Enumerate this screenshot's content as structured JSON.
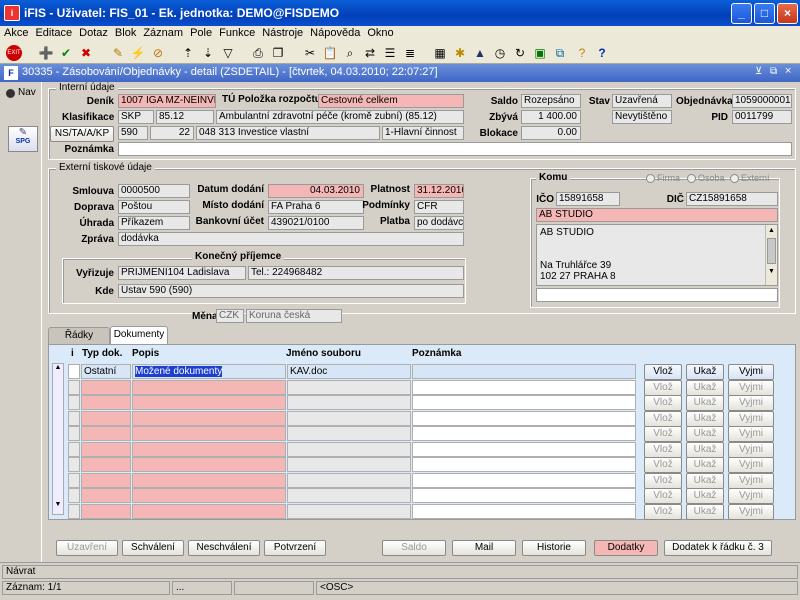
{
  "app": {
    "title": "iFIS - Uživatel: FIS_01 - Ek. jednotka: DEMO@FISDEMO"
  },
  "menu": [
    "Akce",
    "Editace",
    "Dotaz",
    "Blok",
    "Záznam",
    "Pole",
    "Funkce",
    "Nástroje",
    "Nápověda",
    "Okno"
  ],
  "subwindow": {
    "title": "30335 - Zásobování/Objednávky - detail (ZSDETAIL) - [čtvrtek, 04.03.2010; 22:07:27]"
  },
  "left": {
    "nav_label": "Nav",
    "spg_label": "SPG"
  },
  "interni": {
    "group_label": "Interní údaje",
    "denik_label": "Deník",
    "denik_value": "1007 IGA MZ-NEINVESTI",
    "tu_label": "TÚ Položka rozpočtu",
    "tu_value": "Cestovné celkem",
    "saldo_label": "Saldo",
    "saldo_value": "Rozepsáno",
    "stav_label": "Stav",
    "stav_value": "Uzavřená",
    "objednavka_label": "Objednávka",
    "objednavka_value": "1059000001",
    "klasifikace_label": "Klasifikace",
    "klasifikace_code": "SKP",
    "klasifikace_num": "85.12",
    "klasifikace_desc": "Ambulantní zdravotní péče (kromě zubní) (85.12)",
    "zbyva_label": "Zbývá",
    "zbyva_value": "1 400.00",
    "nevytisteno": "Nevytištěno",
    "pid_label": "PID",
    "pid_value": "0011799",
    "nsta_button": "NS/TA/A/KP",
    "ns_value": "590",
    "ta_value": "22",
    "a_value": "048 313 Investice vlastní",
    "kp_value": "1-Hlavní činnost",
    "blokace_label": "Blokace",
    "blokace_value": "0.00",
    "poznamka_label": "Poznámka",
    "poznamka_value": ""
  },
  "externi": {
    "group_label": "Externí tiskové údaje",
    "smlouva_label": "Smlouva",
    "smlouva_value": "0000500",
    "datum_label": "Datum dodání",
    "datum_value": "04.03.2010",
    "platnost_label": "Platnost",
    "platnost_value": "31.12.2010",
    "doprava_label": "Doprava",
    "doprava_value": "Poštou",
    "misto_label": "Místo dodání",
    "misto_value": "FA Praha 6",
    "podminky_label": "Podmínky",
    "podminky_value": "CFR",
    "uhrada_label": "Úhrada",
    "uhrada_value": "Příkazem",
    "ucet_label": "Bankovní účet",
    "ucet_value": "439021/0100",
    "platba_label": "Platba",
    "platba_value": "po dodávce",
    "zprava_label": "Zpráva",
    "zprava_value": "dodávka",
    "konecny_label": "Konečný příjemce",
    "vyrizuje_label": "Vyřizuje",
    "vyrizuje_value": "PRIJMENI104 Ladislava",
    "tel_value": "Tel.: 224968482",
    "kde_label": "Kde",
    "kde_value": "Ústav 590 (590)",
    "mena_label": "Měna",
    "mena_code": "CZK",
    "mena_name": "Koruna česká"
  },
  "komu": {
    "group_label": "Komu",
    "firma": "Firma",
    "osoba": "Osoba",
    "externi": "Externí",
    "ico_label": "IČO",
    "ico_value": "15891658",
    "dic_label": "DIČ",
    "dic_value": "CZ15891658",
    "name_value": "AB STUDIO",
    "address_line1": "AB STUDIO",
    "address_line2": "Na Truhlářce  39",
    "address_line3": "102 27  PRAHA 8"
  },
  "tabs": [
    "Řádky",
    "Dokumenty"
  ],
  "grid": {
    "headers": {
      "i": "i",
      "typ": "Typ dok.",
      "popis": "Popis",
      "soubor": "Jméno souboru",
      "poznamka": "Poznámka"
    },
    "rows": [
      {
        "typ": "Ostatní",
        "popis": "Možené dokumenty",
        "soubor": "KAV.doc",
        "poznamka": ""
      }
    ],
    "row_buttons": {
      "vloz": "Vlož",
      "ukaz": "Ukaž",
      "vyjmi": "Vyjmi"
    }
  },
  "bottom_buttons": [
    "Uzavření",
    "Schválení",
    "Neschválení",
    "Potvrzení",
    "Saldo",
    "Mail",
    "Historie",
    "Dodatky",
    "Dodatek k řádku č.  3"
  ],
  "status": {
    "line1": "Návrat",
    "zaznam": "Záznam: 1/1",
    "dots": "...",
    "osc": "<OSC>"
  }
}
